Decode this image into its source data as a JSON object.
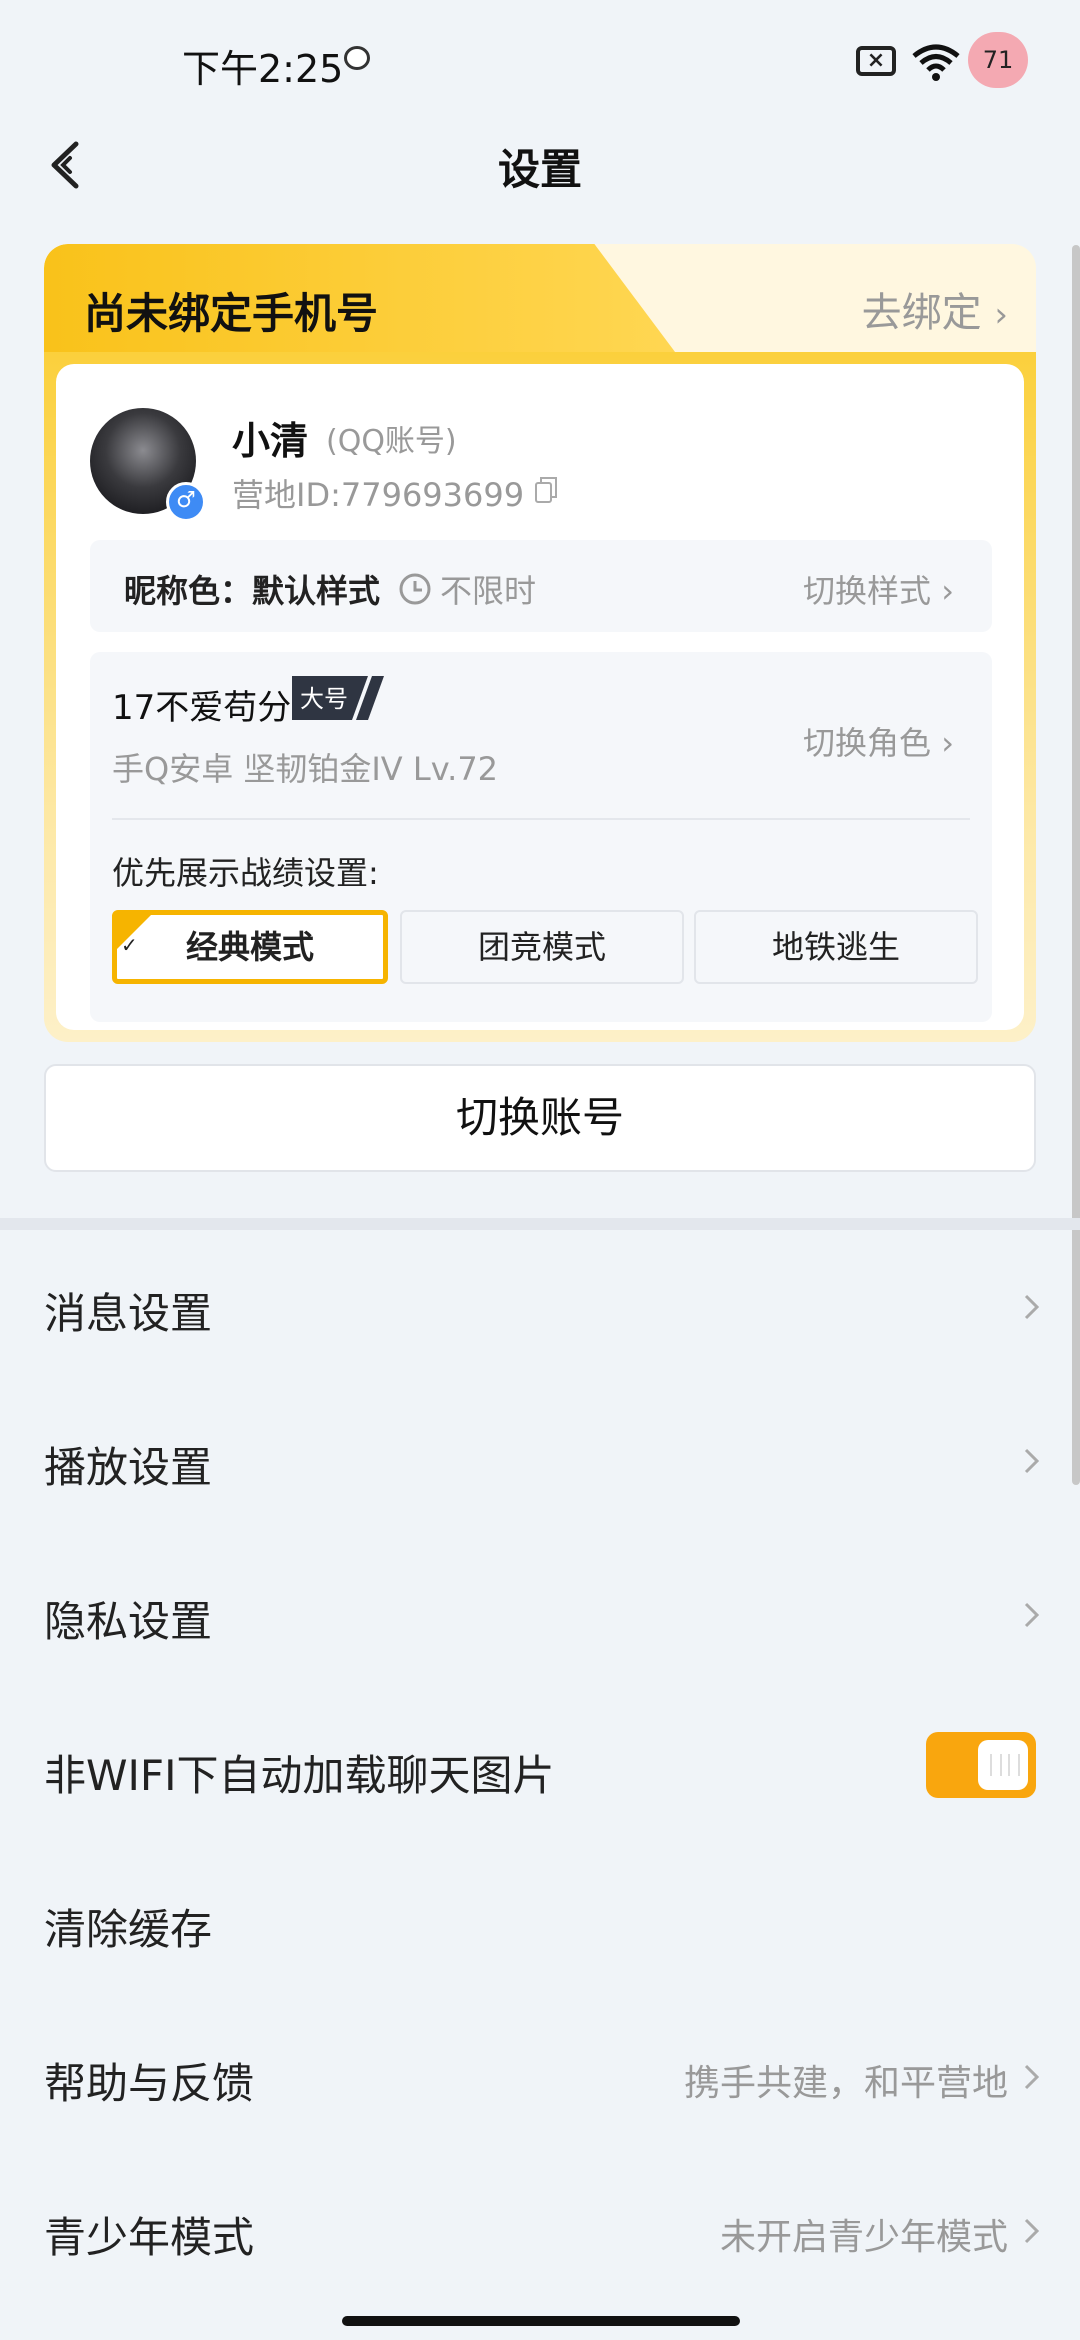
{
  "status_bar": {
    "time": "下午2:25",
    "battery": "71"
  },
  "header": {
    "title": "设置"
  },
  "account_card": {
    "banner_title": "尚未绑定手机号",
    "banner_link": "去绑定",
    "user_name": "小清",
    "account_type": "(QQ账号)",
    "camp_id": "营地ID:779693699",
    "gender_symbol": "♂",
    "nickname_color_label": "昵称色：默认样式",
    "nickname_time": "不限时",
    "switch_style": "切换样式",
    "role_name": "17不爱苟分",
    "role_tag": "大号",
    "role_info": "手Q安卓  坚韧铂金IV  Lv.72",
    "switch_role": "切换角色",
    "pref_label": "优先展示战绩设置:",
    "modes": [
      {
        "label": "经典模式",
        "active": true
      },
      {
        "label": "团竞模式",
        "active": false
      },
      {
        "label": "地铁逃生",
        "active": false
      }
    ]
  },
  "switch_account": "切换账号",
  "menu": [
    {
      "label": "消息设置",
      "sub": "",
      "type": "chevron"
    },
    {
      "label": "播放设置",
      "sub": "",
      "type": "chevron"
    },
    {
      "label": "隐私设置",
      "sub": "",
      "type": "chevron"
    },
    {
      "label": "非WIFI下自动加载聊天图片",
      "sub": "",
      "type": "toggle",
      "on": true
    },
    {
      "label": "清除缓存",
      "sub": "",
      "type": "none"
    },
    {
      "label": "帮助与反馈",
      "sub": "携手共建，和平营地",
      "type": "chevron"
    },
    {
      "label": "青少年模式",
      "sub": "未开启青少年模式",
      "type": "chevron"
    }
  ],
  "colors": {
    "accent": "#f9a60e",
    "banner_gold": "#f9c21a",
    "page_bg": "#f0f4f8"
  }
}
